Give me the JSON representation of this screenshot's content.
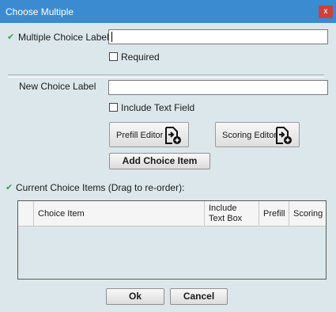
{
  "window": {
    "title": "Choose Multiple",
    "close_label": "x"
  },
  "form": {
    "multiple_choice_label": "Multiple Choice Label",
    "multiple_choice_value": "",
    "required_label": "Required",
    "required_checked": false,
    "new_choice_label": "New Choice Label",
    "new_choice_value": "",
    "include_text_field_label": "Include Text Field",
    "include_text_field_checked": false,
    "prefill_editor_label": "Prefill Editor",
    "scoring_editor_label": "Scoring Editor",
    "add_choice_item_label": "Add Choice Item",
    "current_items_label": "Current Choice Items (Drag to re-order):"
  },
  "table": {
    "columns": [
      "Choice Item",
      "Include",
      "Text Box",
      "Prefill",
      "Scoring"
    ],
    "rows": []
  },
  "footer": {
    "ok_label": "Ok",
    "cancel_label": "Cancel"
  },
  "colors": {
    "titlebar": "#3b8bd0",
    "close": "#c9433c",
    "dialog_bg": "#dce7eb",
    "check": "#3aa14a"
  }
}
